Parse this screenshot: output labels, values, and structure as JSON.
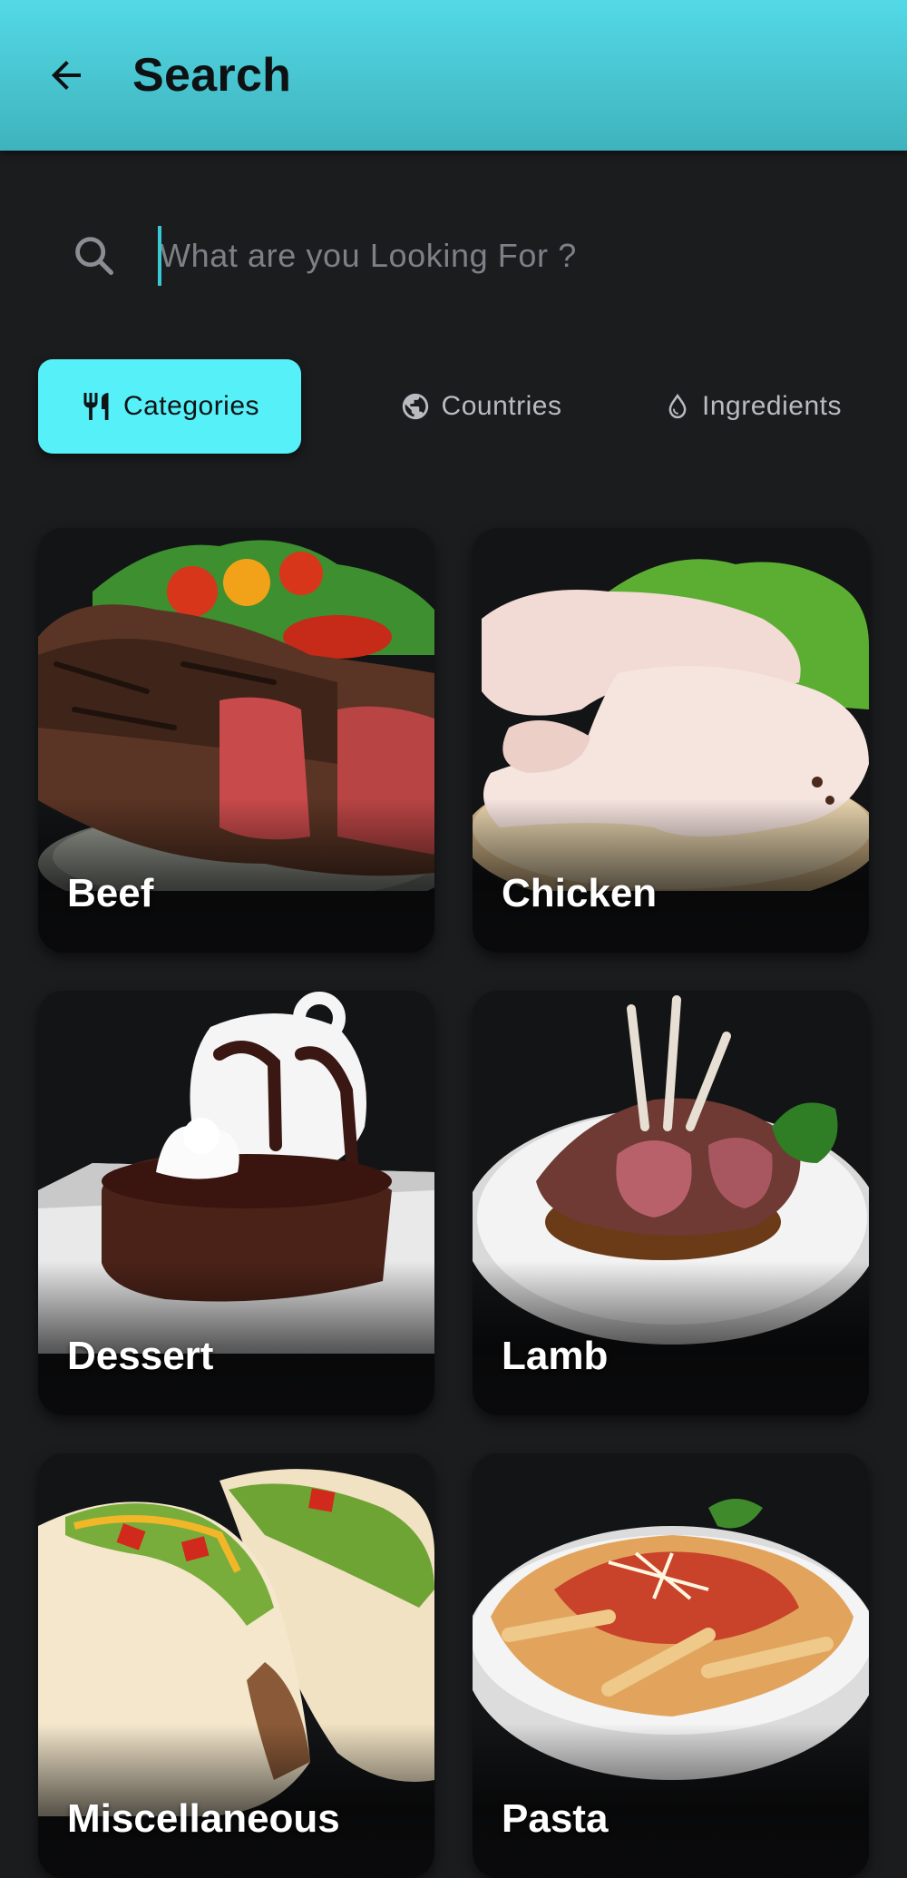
{
  "header": {
    "title": "Search",
    "back_icon": "arrow-back-icon",
    "background": "#4fd0dc"
  },
  "search": {
    "placeholder": "What are you Looking For ?",
    "value": "",
    "icon": "search-icon"
  },
  "tabs": [
    {
      "label": "Categories",
      "icon": "fork-knife-icon",
      "active": true
    },
    {
      "label": "Countries",
      "icon": "globe-icon",
      "active": false
    },
    {
      "label": "Ingredients",
      "icon": "drop-icon",
      "active": false
    }
  ],
  "accent_color": "#56f0f9",
  "categories": [
    {
      "label": "Beef"
    },
    {
      "label": "Chicken"
    },
    {
      "label": "Dessert"
    },
    {
      "label": "Lamb"
    },
    {
      "label": "Miscellaneous"
    },
    {
      "label": "Pasta"
    }
  ]
}
